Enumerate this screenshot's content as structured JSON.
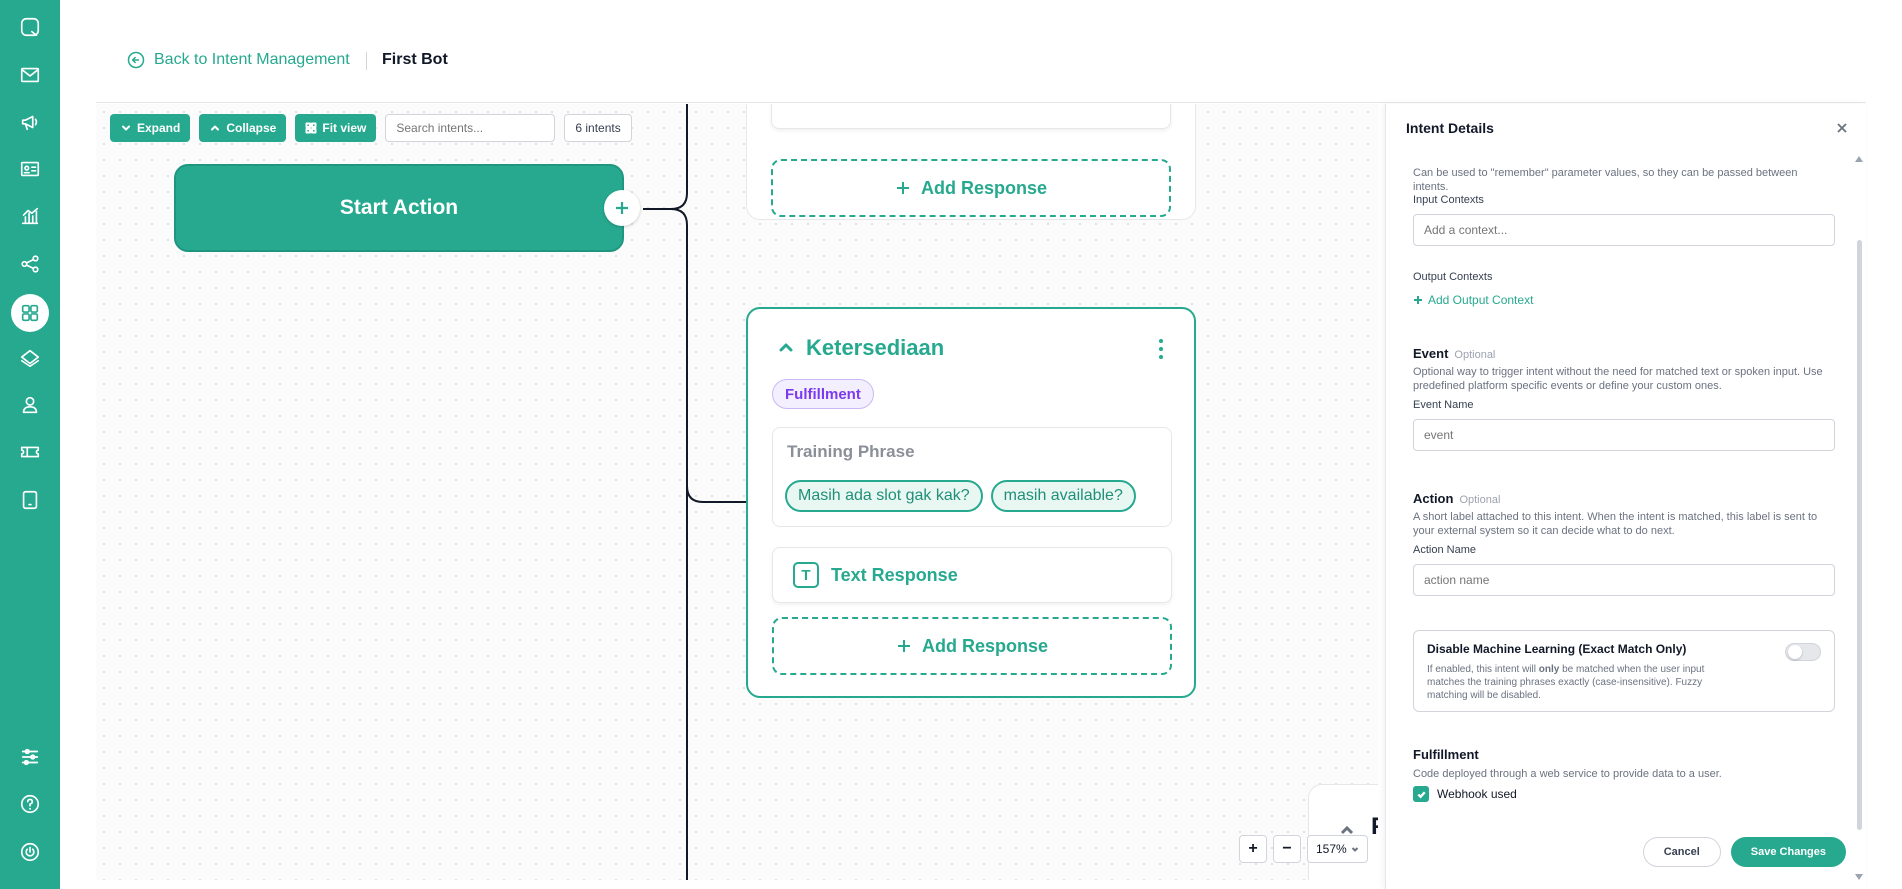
{
  "header": {
    "back_label": "Back to Intent Management",
    "bot_name": "First Bot"
  },
  "toolbar": {
    "expand_label": "Expand",
    "collapse_label": "Collapse",
    "fit_label": "Fit view",
    "search_placeholder": "Search intents...",
    "intent_count": "6 intents"
  },
  "canvas": {
    "start_node_label": "Start Action",
    "add_response_label": "Add Response",
    "intent": {
      "title": "Ketersediaan",
      "badge": "Fulfillment",
      "training_title": "Training Phrase",
      "phrases": [
        "Masih ada slot gak kak?",
        "masih available?"
      ],
      "text_response_label": "Text Response",
      "text_response_icon": "T",
      "add_response_label": "Add Response"
    },
    "bottom_card_letter": "F",
    "zoom": {
      "plus": "+",
      "minus": "−",
      "level": "157%"
    }
  },
  "panel": {
    "title": "Intent Details",
    "context_desc": "Can be used to \"remember\" parameter values, so they can be passed between intents.",
    "input_contexts_label": "Input Contexts",
    "input_contexts_placeholder": "Add a context...",
    "output_contexts_label": "Output Contexts",
    "add_output_context": "Add Output Context",
    "event_title": "Event",
    "event_optional": "Optional",
    "event_desc": "Optional way to trigger intent without the need for matched text or spoken input. Use predefined platform specific events or define your custom ones.",
    "event_name_label": "Event Name",
    "event_placeholder": "event",
    "action_title": "Action",
    "action_optional": "Optional",
    "action_desc": "A short label attached to this intent. When the intent is matched, this label is sent to your external system so it can decide what to do next.",
    "action_name_label": "Action Name",
    "action_placeholder": "action name",
    "ml_title": "Disable Machine Learning (Exact Match Only)",
    "ml_desc_1": "If enabled, this intent will ",
    "ml_desc_bold": "only",
    "ml_desc_2": " be matched when the user input matches the training phrases exactly (case-insensitive). Fuzzy matching will be disabled.",
    "fulfillment_title": "Fulfillment",
    "fulfillment_desc": "Code deployed through a web service to provide data to a user.",
    "webhook_label": "Webhook used",
    "cancel_label": "Cancel",
    "save_label": "Save Changes"
  },
  "colors": {
    "brand": "#26a98f",
    "badge_purple": "#7c3aed"
  },
  "icons": [
    "logo-icon",
    "mail-icon",
    "megaphone-icon",
    "contact-card-icon",
    "analytics-icon",
    "share-nodes-icon",
    "grid-icon",
    "layers-icon",
    "user-icon",
    "ticket-icon",
    "tablet-icon",
    "sliders-icon",
    "help-icon",
    "power-icon"
  ]
}
